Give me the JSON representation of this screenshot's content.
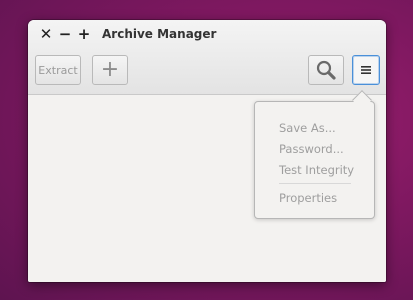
{
  "window": {
    "title": "Archive Manager"
  },
  "controls": {
    "close": "✕",
    "minimize": "−",
    "maximize": "+"
  },
  "toolbar": {
    "extract_label": "Extract",
    "add_glyph": "+"
  },
  "menu": {
    "items": [
      "Save As...",
      "Password...",
      "Test Integrity",
      "Properties"
    ]
  },
  "icons": {
    "search": "search-icon",
    "menu": "hamburger-menu-icon",
    "add": "plus-icon"
  },
  "colors": {
    "accent": "#4a90d9",
    "desktop": "#7e1860"
  }
}
